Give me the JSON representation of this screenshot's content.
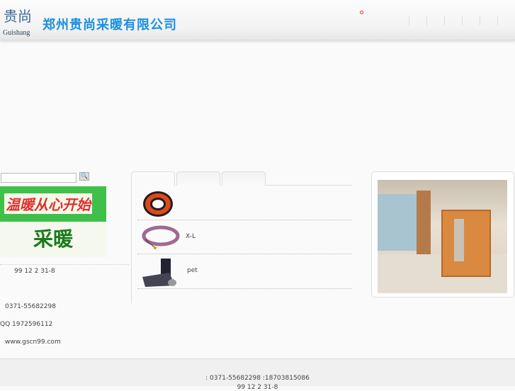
{
  "header": {
    "logo_mark": "贵尚",
    "logo_en": "Guishang",
    "company": "郑州贵尚采暖有限公司"
  },
  "sidebar": {
    "search_placeholder": "",
    "search_button": "🔍",
    "banner_line1": "温暖从心开始",
    "banner_line2": "采暖",
    "date": "99 12 2 31-8",
    "phone": "0371-55682298",
    "qq": "QQ 1972596112",
    "website": "www.gscn99.com"
  },
  "products": [
    {
      "name": ""
    },
    {
      "name": "X-L"
    },
    {
      "name": "pet"
    }
  ],
  "footer": {
    "line1": ": 0371-55682298   :18703815086",
    "line2": "99 12  2  31-8"
  }
}
